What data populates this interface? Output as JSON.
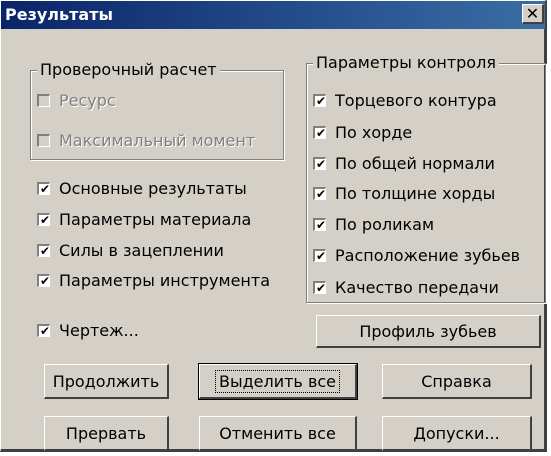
{
  "window": {
    "title": "Результаты",
    "close_symbol": "✕"
  },
  "check_groups": {
    "verification": {
      "title": "Проверочный расчет",
      "items": [
        {
          "label": "Ресурс",
          "checked": false,
          "disabled": true
        },
        {
          "label": "Максимальный момент",
          "checked": false,
          "disabled": true
        }
      ]
    },
    "control": {
      "title": "Параметры контроля",
      "items": [
        {
          "label": "Торцевого контура",
          "checked": true
        },
        {
          "label": "По хорде",
          "checked": true
        },
        {
          "label": "По общей нормали",
          "checked": true
        },
        {
          "label": "По толщине хорды",
          "checked": true
        },
        {
          "label": "По роликам",
          "checked": true
        },
        {
          "label": "Расположение зубьев",
          "checked": true
        },
        {
          "label": "Качество передачи",
          "checked": true
        }
      ]
    }
  },
  "options": [
    {
      "label": "Основные результаты",
      "checked": true
    },
    {
      "label": "Параметры материала",
      "checked": true
    },
    {
      "label": "Силы в зацеплении",
      "checked": true
    },
    {
      "label": "Параметры инструмента",
      "checked": true
    },
    {
      "label": "Чертеж...",
      "checked": true
    }
  ],
  "buttons": {
    "tooth_profile": "Профиль зубьев",
    "continue": "Продолжить",
    "select_all": "Выделить все",
    "help": "Справка",
    "abort": "Прервать",
    "deselect_all": "Отменить все",
    "tolerances": "Допуски..."
  },
  "colors": {
    "face": "#d4d0c8",
    "title_start": "#0a246a",
    "title_end": "#3a6ea5"
  },
  "check_mark": "✔"
}
